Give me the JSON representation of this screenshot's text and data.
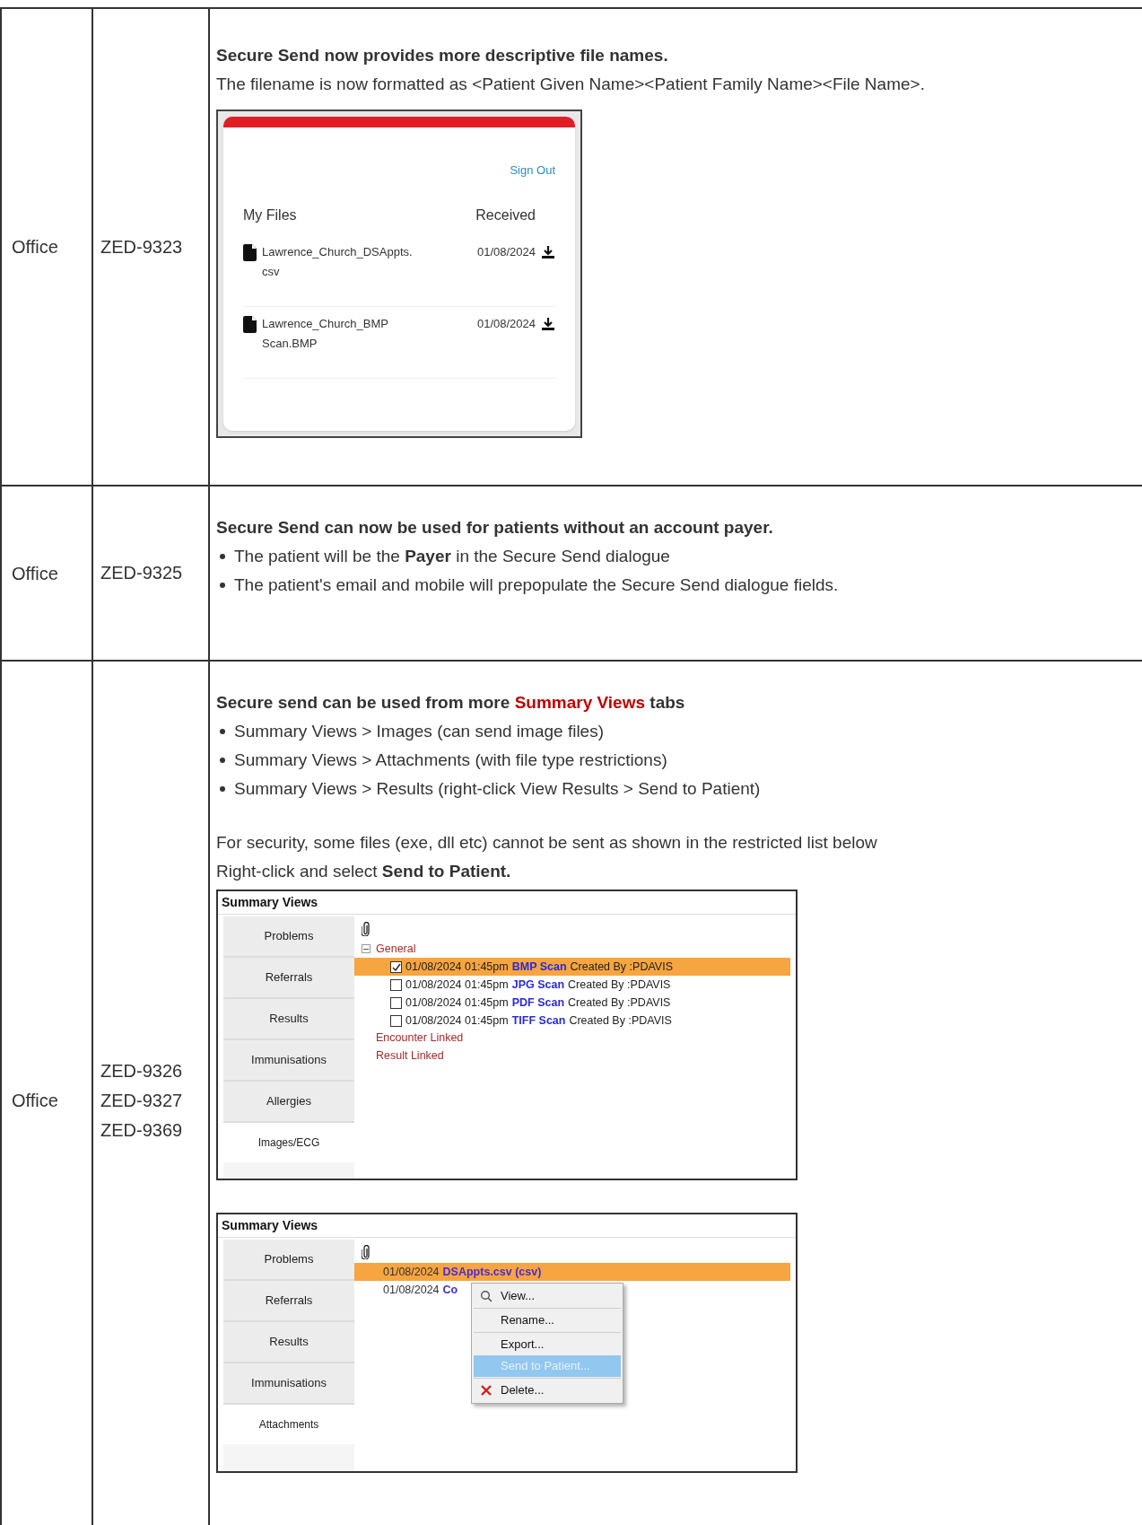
{
  "rows": [
    {
      "area": "Office",
      "tickets": [
        "ZED-9323"
      ],
      "content": [
        {
          "kind": "heading",
          "parts": [
            {
              "text": "Secure Send now provides more descriptive file names."
            }
          ]
        },
        {
          "kind": "paragraph",
          "text": "The filename is now formatted as <Patient Given Name><Patient Family Name><File Name>."
        },
        {
          "kind": "portal",
          "sign_out": "Sign Out",
          "columns": [
            "My Files",
            "Received"
          ],
          "files": [
            {
              "name_lines": [
                "Lawrence_Church_DSAppts.",
                "csv"
              ],
              "date": "01/08/2024"
            },
            {
              "name_lines": [
                "Lawrence_Church_BMP",
                "Scan.BMP"
              ],
              "date": "01/08/2024"
            }
          ]
        }
      ]
    },
    {
      "area": "Office",
      "tickets": [
        "ZED-9325"
      ],
      "content": [
        {
          "kind": "heading",
          "parts": [
            {
              "text": "Secure Send can now be used for patients without an account payer."
            }
          ]
        },
        {
          "kind": "bullets",
          "items": [
            "The patient will be the **Payer** in the Secure Send dialogue",
            "The patient's email and mobile will prepopulate the Secure Send dialogue fields."
          ]
        }
      ]
    },
    {
      "area": "Office",
      "tickets": [
        "ZED-9326",
        "ZED-9327",
        "ZED-9369"
      ],
      "content": [
        {
          "kind": "heading",
          "parts": [
            {
              "text": "Secure send can be used from more "
            },
            {
              "text": "Summary Views",
              "color": "#c00000"
            },
            {
              "text": " tabs"
            }
          ]
        },
        {
          "kind": "bullets",
          "items": [
            "Summary Views > Images (can send image files)",
            "Summary Views > Attachments (with file type restrictions)",
            "Summary Views > Results (right-click View Results > Send to Patient)"
          ]
        },
        {
          "kind": "paragraph",
          "text": "For security, some files (exe, dll etc) cannot be sent as shown in the restricted list below"
        },
        {
          "kind": "paragraph",
          "text": "Right-click and select **Send to Patient.**"
        },
        {
          "kind": "summary_tree",
          "title": "Summary Views",
          "tabs": [
            {
              "label": "Problems",
              "selected": false
            },
            {
              "label": "Referrals",
              "selected": false
            },
            {
              "label": "Results",
              "selected": false
            },
            {
              "label": "Immunisations",
              "selected": false
            },
            {
              "label": "Allergies",
              "selected": false
            },
            {
              "label": "Images/ECG",
              "selected": true
            }
          ],
          "group": {
            "label": "General",
            "expanded": true,
            "items": [
              {
                "stamp": "01/08/2024 01:45pm",
                "name": "BMP Scan",
                "author": "Created By :PDAVIS",
                "checked": true,
                "selected": true
              },
              {
                "stamp": "01/08/2024 01:45pm",
                "name": "JPG Scan",
                "author": "Created By :PDAVIS",
                "checked": false,
                "selected": false
              },
              {
                "stamp": "01/08/2024 01:45pm",
                "name": "PDF Scan",
                "author": "Created By :PDAVIS",
                "checked": false,
                "selected": false
              },
              {
                "stamp": "01/08/2024 01:45pm",
                "name": "TIFF Scan",
                "author": "Created By :PDAVIS",
                "checked": false,
                "selected": false
              }
            ]
          },
          "other_groups": [
            "Encounter Linked",
            "Result Linked"
          ]
        },
        {
          "kind": "summary_menu",
          "title": "Summary Views",
          "tabs": [
            {
              "label": "Problems",
              "selected": false
            },
            {
              "label": "Referrals",
              "selected": false
            },
            {
              "label": "Results",
              "selected": false
            },
            {
              "label": "Immunisations",
              "selected": false
            },
            {
              "label": "Attachments",
              "selected": true
            }
          ],
          "items": [
            {
              "stamp": "01/08/2024",
              "name": "DSAppts.csv (csv)",
              "selected": true
            },
            {
              "stamp": "01/08/2024",
              "name": "Co",
              "selected": false
            }
          ],
          "menu": [
            {
              "label": "View...",
              "selected": false
            },
            {
              "label": "Rename...",
              "selected": false
            },
            {
              "label": "Export...",
              "selected": false
            },
            {
              "label": "Send to Patient...",
              "selected": true
            },
            {
              "label": "Delete...",
              "selected": false
            }
          ]
        }
      ]
    }
  ]
}
